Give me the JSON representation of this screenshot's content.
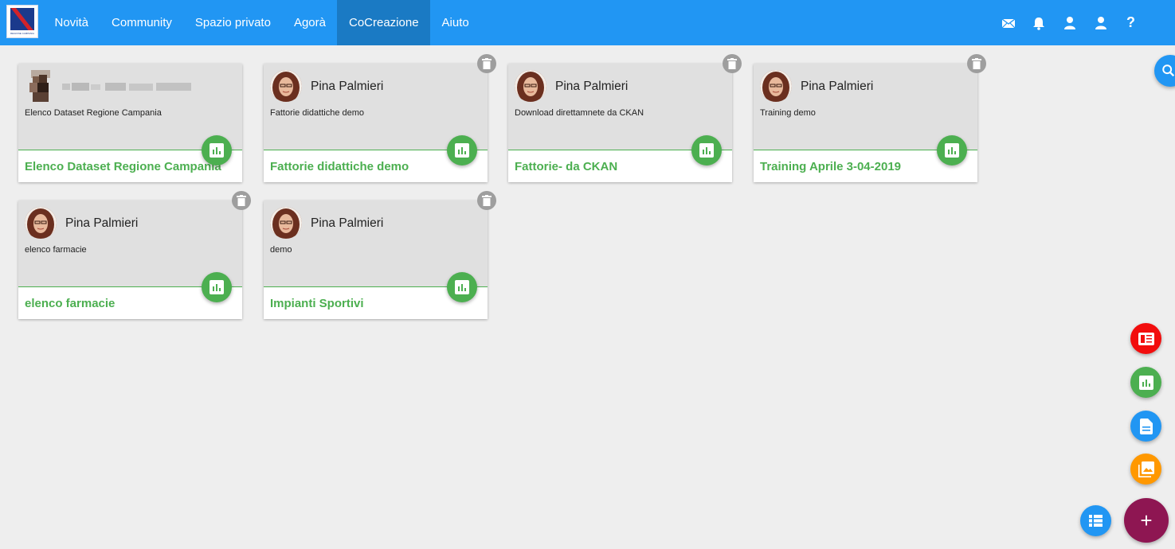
{
  "header": {
    "logo_text": "REGIONE CAMPANIA",
    "nav": [
      "Novità",
      "Community",
      "Spazio privato",
      "Agorà",
      "CoCreazione",
      "Aiuto"
    ],
    "active_nav": "CoCreazione",
    "icons": [
      "mail-icon",
      "bell-icon",
      "user-icon",
      "user-icon",
      "help-icon"
    ],
    "help_label": "?"
  },
  "colors": {
    "topbar": "#2196f3",
    "active_tab": "#1a7ac4",
    "green": "#4caf50",
    "red": "#f20d0d",
    "blue": "#2196f3",
    "orange": "#ff9800",
    "maroon": "#8e1652",
    "grey": "#9e9e9e"
  },
  "cards": [
    {
      "author": "",
      "author_blurred": true,
      "description": "Elenco Dataset Regione Campania",
      "title": "Elenco Dataset Regione Campania",
      "has_delete": false
    },
    {
      "author": "Pina Palmieri",
      "description": "Fattorie didattiche demo",
      "title": "Fattorie didattiche demo",
      "has_delete": true
    },
    {
      "author": "Pina Palmieri",
      "description": "Download direttamnete da CKAN",
      "title": "Fattorie- da CKAN",
      "has_delete": true
    },
    {
      "author": "Pina Palmieri",
      "description": "Training demo",
      "title": "Training Aprile 3-04-2019",
      "has_delete": true
    },
    {
      "author": "Pina Palmieri",
      "description": "elenco farmacie",
      "title": "elenco farmacie",
      "has_delete": true
    },
    {
      "author": "Pina Palmieri",
      "description": "demo",
      "title": "Impianti Sportivi",
      "has_delete": true
    }
  ],
  "fabs": {
    "search": "search-icon",
    "speed_dial": [
      "news-icon",
      "chart-icon",
      "document-icon",
      "image-icon"
    ],
    "list": "list-icon",
    "add_label": "+"
  }
}
